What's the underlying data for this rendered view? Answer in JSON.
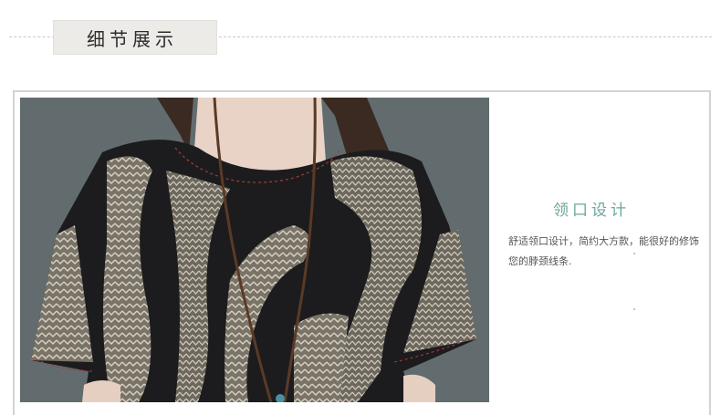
{
  "header": {
    "title": "细节展示"
  },
  "detail": {
    "title": "领口设计",
    "description": "舒适领口设计，简约大方款，能很好的修饰您的脖颈线条."
  },
  "photo": {
    "subject": "product-photo"
  }
}
